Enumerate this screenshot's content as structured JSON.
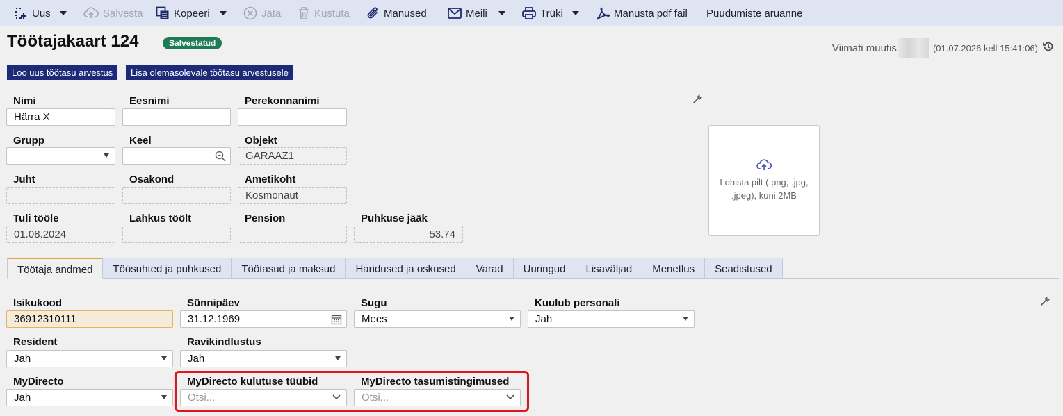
{
  "toolbar": {
    "new": "Uus",
    "save": "Salvesta",
    "copy": "Kopeeri",
    "cancel": "Jäta",
    "delete": "Kustuta",
    "attachments": "Manused",
    "mail": "Meili",
    "print": "Trüki",
    "attach_pdf": "Manusta pdf fail",
    "absence_report": "Puudumiste aruanne"
  },
  "header": {
    "title": "Töötajakaart 124",
    "status": "Salvestatud",
    "last_modified_label": "Viimati muutis",
    "last_modified_date": "(01.07.2026 kell 15:41:06)"
  },
  "actions": {
    "new_salary_calc": "Loo uus töötasu arvestus",
    "add_to_salary_calc": "Lisa olemasolevale töötasu arvestusele"
  },
  "fields": {
    "nimi": {
      "label": "Nimi",
      "value": "Härra X"
    },
    "eesnimi": {
      "label": "Eesnimi",
      "value": ""
    },
    "perekonnanimi": {
      "label": "Perekonnanimi",
      "value": ""
    },
    "grupp": {
      "label": "Grupp",
      "value": ""
    },
    "keel": {
      "label": "Keel",
      "value": ""
    },
    "objekt": {
      "label": "Objekt",
      "value": "GARAAZ1"
    },
    "juht": {
      "label": "Juht",
      "value": ""
    },
    "osakond": {
      "label": "Osakond",
      "value": ""
    },
    "ametikoht": {
      "label": "Ametikoht",
      "value": "Kosmonaut"
    },
    "tuli_toole": {
      "label": "Tuli tööle",
      "value": "01.08.2024"
    },
    "lahkus_toolt": {
      "label": "Lahkus töölt",
      "value": ""
    },
    "pension": {
      "label": "Pension",
      "value": ""
    },
    "puhkuse_jaak": {
      "label": "Puhkuse jääk",
      "value": "53.74"
    }
  },
  "upload": {
    "text": "Lohista pilt (.png, .jpg, .jpeg), kuni 2MB"
  },
  "tabs": [
    "Töötaja andmed",
    "Töösuhted ja puhkused",
    "Töötasud ja maksud",
    "Haridused ja oskused",
    "Varad",
    "Uuringud",
    "Lisaväljad",
    "Menetlus",
    "Seadistused"
  ],
  "details": {
    "isikukood": {
      "label": "Isikukood",
      "value": "36912310111"
    },
    "synnipaev": {
      "label": "Sünnipäev",
      "value": "31.12.1969"
    },
    "sugu": {
      "label": "Sugu",
      "value": "Mees"
    },
    "kuulub_personali": {
      "label": "Kuulub personali",
      "value": "Jah"
    },
    "resident": {
      "label": "Resident",
      "value": "Jah"
    },
    "ravikindlustus": {
      "label": "Ravikindlustus",
      "value": "Jah"
    },
    "mydirecto": {
      "label": "MyDirecto",
      "value": "Jah"
    },
    "mydirecto_kulutuse": {
      "label": "MyDirecto kulutuse tüübid",
      "placeholder": "Otsi..."
    },
    "mydirecto_tasumis": {
      "label": "MyDirecto tasumistingimused",
      "placeholder": "Otsi..."
    }
  },
  "colors": {
    "toolbar_bg": "#dfe4f3",
    "action_button": "#1c2a79",
    "status_badge": "#1f7a56",
    "highlight_box": "#e3141c"
  }
}
